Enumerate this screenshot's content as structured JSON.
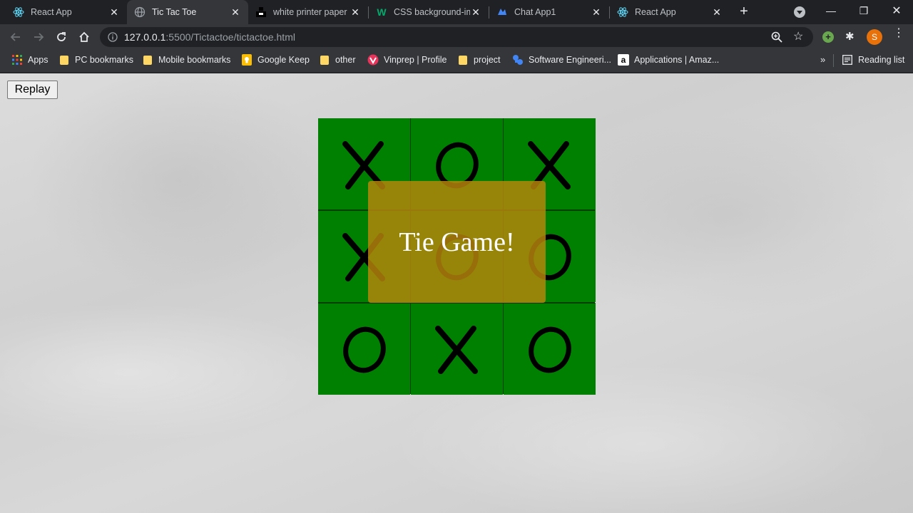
{
  "browser": {
    "tabs": [
      {
        "title": "React App",
        "icon": "react-icon",
        "active": false
      },
      {
        "title": "Tic Tac Toe",
        "icon": "globe-icon",
        "active": true
      },
      {
        "title": "white printer paper",
        "icon": "unsplash-icon",
        "active": false
      },
      {
        "title": "CSS background-im",
        "icon": "w3schools-icon",
        "active": false
      },
      {
        "title": "Chat App1",
        "icon": "app-icon",
        "active": false
      },
      {
        "title": "React App",
        "icon": "react-icon",
        "active": false
      }
    ],
    "address": {
      "host": "127.0.0.1",
      "path": ":5500/Tictactoe/tictactoe.html"
    },
    "profile_initial": "S",
    "bookmarks": [
      {
        "label": "Apps",
        "icon": "apps-grid-icon"
      },
      {
        "label": "PC bookmarks",
        "icon": "folder-icon"
      },
      {
        "label": "Mobile bookmarks",
        "icon": "folder-icon"
      },
      {
        "label": "Google Keep",
        "icon": "keep-icon"
      },
      {
        "label": "other",
        "icon": "folder-icon"
      },
      {
        "label": "Vinprep | Profile",
        "icon": "vinprep-icon"
      },
      {
        "label": "project",
        "icon": "folder-icon"
      },
      {
        "label": "Software Engineeri...",
        "icon": "software-icon"
      },
      {
        "label": "Applications | Amaz...",
        "icon": "amazon-icon"
      }
    ],
    "more_bookmarks": "»",
    "reading_list": "Reading list"
  },
  "game": {
    "replay_label": "Replay",
    "board": [
      "X",
      "O",
      "X",
      "X",
      "O",
      "O",
      "O",
      "X",
      "O"
    ],
    "result_message": "Tie Game!",
    "colors": {
      "board": "#008000",
      "overlay": "#b8860b",
      "mark": "#000000"
    }
  }
}
